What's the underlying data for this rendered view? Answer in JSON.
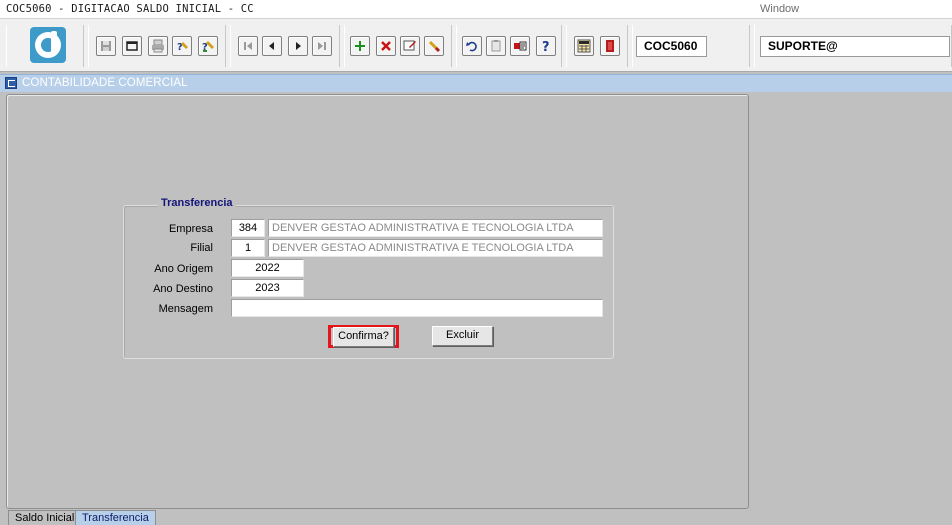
{
  "titlebar": {
    "title": "COC5060 - DIGITACAO SALDO INICIAL - CC",
    "menu_window": "Window"
  },
  "toolbar": {
    "module_code": "COC5060",
    "user": "SUPORTE@",
    "icons": [
      "logo-icon",
      "save-icon",
      "window-icon",
      "print-icon",
      "query-icon",
      "execute-query-icon",
      "first-record-icon",
      "previous-record-icon",
      "next-record-icon",
      "last-record-icon",
      "insert-record-icon",
      "delete-record-icon",
      "edit-icon",
      "clear-icon",
      "undo-icon",
      "paste-icon",
      "settings-icon",
      "help-icon",
      "calculator-icon",
      "exit-icon"
    ]
  },
  "window": {
    "title": "CONTABILIDADE COMERCIAL"
  },
  "form": {
    "frame_title": "Transferencia",
    "empresa": {
      "label": "Empresa",
      "code": "384",
      "name": "DENVER GESTAO ADMINISTRATIVA E TECNOLOGIA LTDA"
    },
    "filial": {
      "label": "Filial",
      "code": "1",
      "name": "DENVER GESTAO ADMINISTRATIVA E TECNOLOGIA LTDA"
    },
    "ano_origem": {
      "label": "Ano Origem",
      "value": "2022"
    },
    "ano_destino": {
      "label": "Ano Destino",
      "value": "2023"
    },
    "mensagem": {
      "label": "Mensagem",
      "value": ""
    },
    "confirm_label": "Confirma?",
    "delete_label": "Excluir",
    "highlight_color": "#e4161c"
  },
  "tabs": [
    {
      "label": "Saldo Inicial",
      "active": false
    },
    {
      "label": "Transferencia",
      "active": true
    }
  ]
}
